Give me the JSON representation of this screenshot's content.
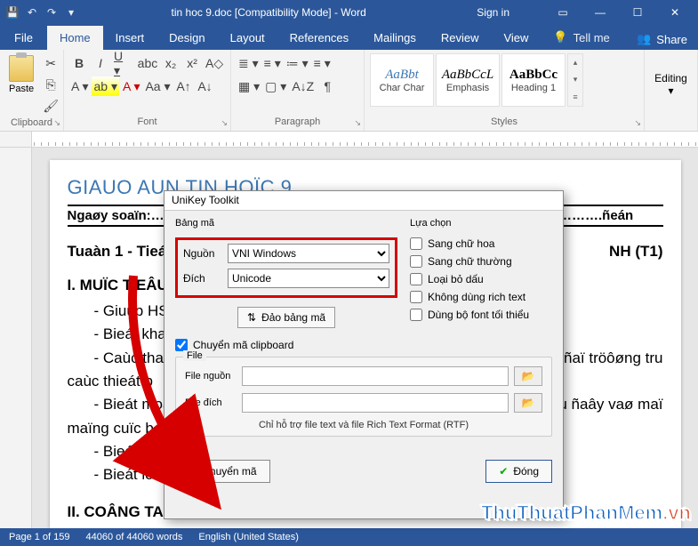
{
  "titlebar": {
    "doc_title": "tin hoc 9.doc [Compatibility Mode] - Word",
    "signin": "Sign in"
  },
  "tabs": {
    "file": "File",
    "home": "Home",
    "insert": "Insert",
    "design": "Design",
    "layout": "Layout",
    "references": "References",
    "mailings": "Mailings",
    "review": "Review",
    "view": "View",
    "tell": "Tell me",
    "share": "Share"
  },
  "ribbon": {
    "paste": "Paste",
    "clipboard": "Clipboard",
    "font": "Font",
    "paragraph": "Paragraph",
    "styles": "Styles",
    "editing": "Editing",
    "style1": {
      "preview": "AaBbt",
      "label": "Char Char"
    },
    "style2": {
      "preview": "AaBbCcL",
      "label": "Emphasis"
    },
    "style3": {
      "preview": "AaBbCc",
      "label": "Heading 1"
    }
  },
  "document": {
    "title": "GIAUO AUN TIN HOÏC 9",
    "meta": "Ngaøy soaïn:…………………………………………………………………………….…/……….ñeán",
    "week": "Tuaàn 1 - Tieát:",
    "week_end": "NH (T1)",
    "h2a": "I. MUÏC TIEÂU",
    "b1": "- Giuùp HS h",
    "b2": "- Bieát khaù",
    "b3": "- Caùc thao",
    "b3_end": "ñaï tröôøng tru",
    "b4": "caùc thieát b",
    "b5": "- Bieát moät",
    "b5_end": "u ñaây vaø maï",
    "b6": "maïng cuïc b",
    "b7": "- Bieát vai tr",
    "b8": "- Bieát lôïi íc",
    "h2b": "II. COÂNG TAUC"
  },
  "dialog": {
    "title": "UniKey Toolkit",
    "bangma": "Bảng mã",
    "nguon": "Nguồn",
    "dich": "Đích",
    "nguon_val": "VNI Windows",
    "dich_val": "Unicode",
    "swap": "Đảo bảng mã",
    "luachon": "Lựa chọn",
    "chk1": "Sang chữ hoa",
    "chk2": "Sang chữ thường",
    "chk3": "Loại bỏ dấu",
    "chk4": "Không dùng rich text",
    "chk5": "Dùng bộ font tối thiểu",
    "clip": "Chuyển mã clipboard",
    "file_legend": "File",
    "file_src": "File nguồn",
    "file_dst": "File đích",
    "file_note": "Chỉ hỗ trợ file text và file Rich Text Format (RTF)",
    "convert": "Chuyển mã",
    "close": "Đóng"
  },
  "statusbar": {
    "page": "Page 1 of 159",
    "words": "44060 of 44060 words",
    "lang": "English (United States)"
  },
  "watermark": {
    "a": "ThuThuatPhanMem",
    "b": ".vn"
  }
}
